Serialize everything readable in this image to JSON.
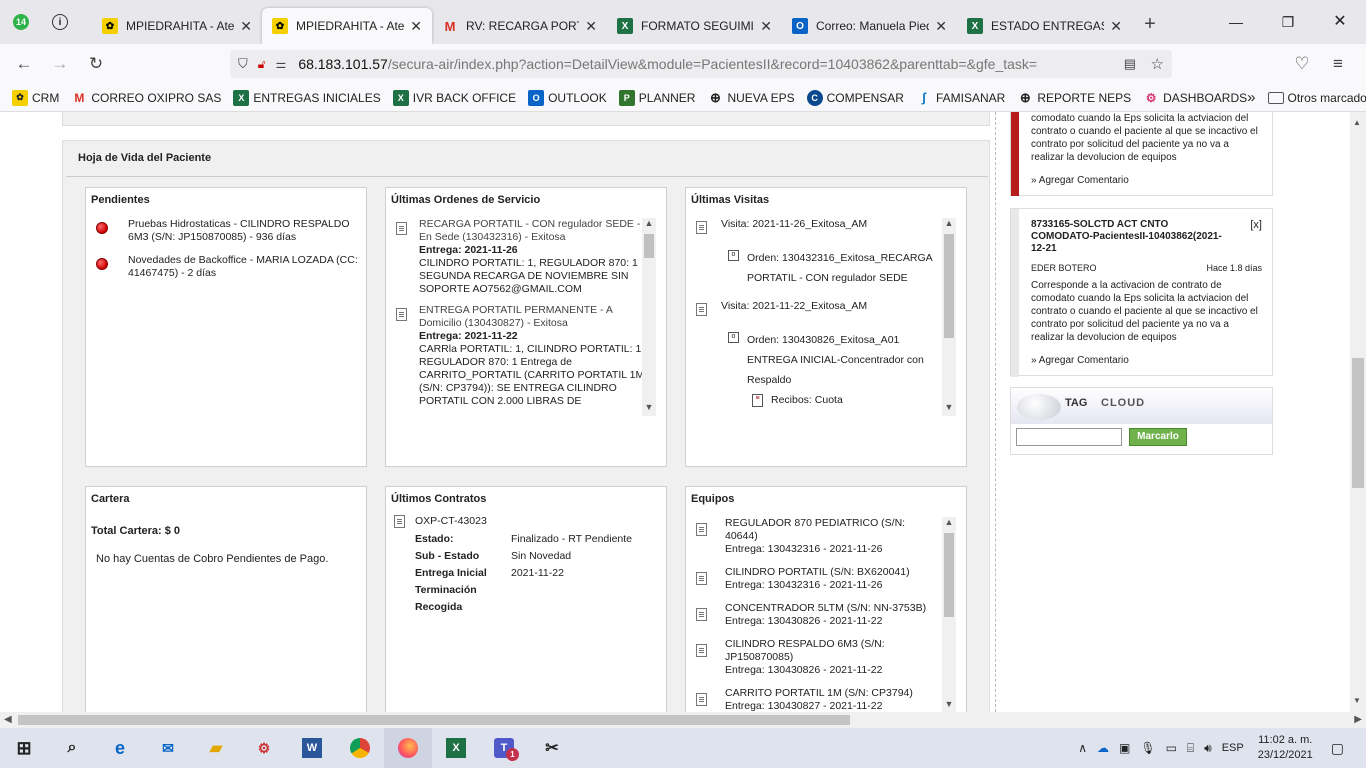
{
  "browser": {
    "badge": "14",
    "tabs": [
      {
        "title": "MPIEDRAHITA - Atenc",
        "fav": "crm"
      },
      {
        "title": "MPIEDRAHITA - Atenc",
        "fav": "crm"
      },
      {
        "title": "RV: RECARGA PORTATI",
        "fav": "gmail"
      },
      {
        "title": "FORMATO SEGUIMIEN",
        "fav": "excel"
      },
      {
        "title": "Correo: Manuela Piedr",
        "fav": "outlook"
      },
      {
        "title": "ESTADO ENTREGAS SA",
        "fav": "excel"
      }
    ],
    "url_host": "68.183.101.57",
    "url_path": "/secura-air/index.php?action=DetailView&module=PacientesII&record=10403862&parenttab=&gfe_task=",
    "bookmarks": [
      "CRM",
      "CORREO OXIPRO SAS",
      "ENTREGAS INICIALES",
      "IVR BACK OFFICE",
      "OUTLOOK",
      "PLANNER",
      "NUEVA EPS",
      "COMPENSAR",
      "FAMISANAR",
      "REPORTE NEPS",
      "DASHBOARDS"
    ],
    "other_bookmarks": "Otros marcadores"
  },
  "page": {
    "section_title": "Hoja de Vida del Paciente",
    "pendientes": {
      "title": "Pendientes",
      "items": [
        "Pruebas Hidrostaticas - CILINDRO RESPALDO 6M3 (S/N: JP150870085) - 936 días",
        "Novedades de Backoffice - MARIA LOZADA (CC: 41467475) - 2 días"
      ]
    },
    "ordenes": {
      "title": "Últimas Ordenes de Servicio",
      "items": [
        {
          "head": "RECARGA PORTATIL - CON regulador SEDE - En Sede (130432316) - Exitosa",
          "entrega": "Entrega: 2021-11-26",
          "body": "CILINDRO PORTATIL: 1, REGULADOR 870: 1 SEGUNDA RECARGA DE NOVIEMBRE SIN SOPORTE AO7562@GMAIL.COM"
        },
        {
          "head": "ENTREGA PORTATIL PERMANENTE - A Domicilio (130430827) - Exitosa",
          "entrega": "Entrega: 2021-11-22",
          "body": "CARRla PORTATIL: 1, CILINDRO PORTATIL: 1, REGULADOR 870: 1 Entrega de CARRITO_PORTATIL (CARRITO PORTATIL 1M (S/N: CP3794)): SE ENTREGA CILINDRO PORTATIL CON 2.000 LIBRAS DE"
        }
      ]
    },
    "visitas": {
      "title": "Últimas Visitas",
      "items": [
        {
          "visita": "Visita: 2021-11-26_Exitosa_AM",
          "orden": "Orden: 130432316_Exitosa_RECARGA PORTATIL - CON regulador SEDE",
          "recibo": ""
        },
        {
          "visita": "Visita: 2021-11-22_Exitosa_AM",
          "orden": "Orden: 130430826_Exitosa_A01 ENTREGA INICIAL-Concentrador con Respaldo",
          "recibo": "Recibos: Cuota"
        }
      ]
    },
    "cartera": {
      "title": "Cartera",
      "total": "Total Cartera: $ 0",
      "msg": "No hay Cuentas de Cobro Pendientes de Pago."
    },
    "contratos": {
      "title": "Últimos Contratos",
      "code": "OXP-CT-43023",
      "rows": [
        {
          "k": "Estado:",
          "v": "Finalizado - RT Pendiente"
        },
        {
          "k": "Sub - Estado",
          "v": "Sin Novedad"
        },
        {
          "k": "Entrega Inicial",
          "v": "2021-11-22"
        },
        {
          "k": "Terminación",
          "v": ""
        },
        {
          "k": "Recogida",
          "v": ""
        }
      ]
    },
    "equipos": {
      "title": "Equipos",
      "items": [
        {
          "name": "REGULADOR 870 PEDIATRICO (S/N: 40644)",
          "entrega": "Entrega: 130432316 - 2021-11-26"
        },
        {
          "name": "CILINDRO PORTATIL (S/N: BX620041)",
          "entrega": "Entrega: 130432316 - 2021-11-26"
        },
        {
          "name": "CONCENTRADOR 5LTM (S/N: NN-3753B)",
          "entrega": "Entrega: 130430826 - 2021-11-22"
        },
        {
          "name": "CILINDRO RESPALDO 6M3 (S/N: JP150870085)",
          "entrega": "Entrega: 130430826 - 2021-11-22"
        },
        {
          "name": "CARRITO PORTATIL 1M (S/N: CP3794)",
          "entrega": "Entrega: 130430827 - 2021-11-22"
        }
      ]
    }
  },
  "side": {
    "comment1_text": "comodato cuando la Eps solicita la actviacion del contrato o cuando el paciente al que se incactivo el contrato por solicitud del paciente ya no va a realizar la devolucion de equipos",
    "add_comment": "» Agregar Comentario",
    "card2": {
      "title": "8733165-SOLCTD ACT CNTO COMODATO-PacientesII-10403862(2021-12-21",
      "close": "[x]",
      "author": "EDER BOTERO",
      "age": "Hace 1.8 días",
      "text": "Corresponde a la activacion de contrato de comodato cuando la Eps solicita la actviacion del contrato o cuando el paciente al que se incactivo el contrato por solicitud del paciente ya no va a realizar la devolucion de equipos",
      "add_comment": "» Agregar Comentario"
    },
    "tagcloud": {
      "title_tag": "TAG",
      "title_cloud": "CLOUD",
      "input_value": "",
      "button": "Marcarlo"
    }
  },
  "taskbar": {
    "lang": "ESP",
    "time": "11:02 a. m.",
    "date": "23/12/2021",
    "teams_badge": "1"
  }
}
